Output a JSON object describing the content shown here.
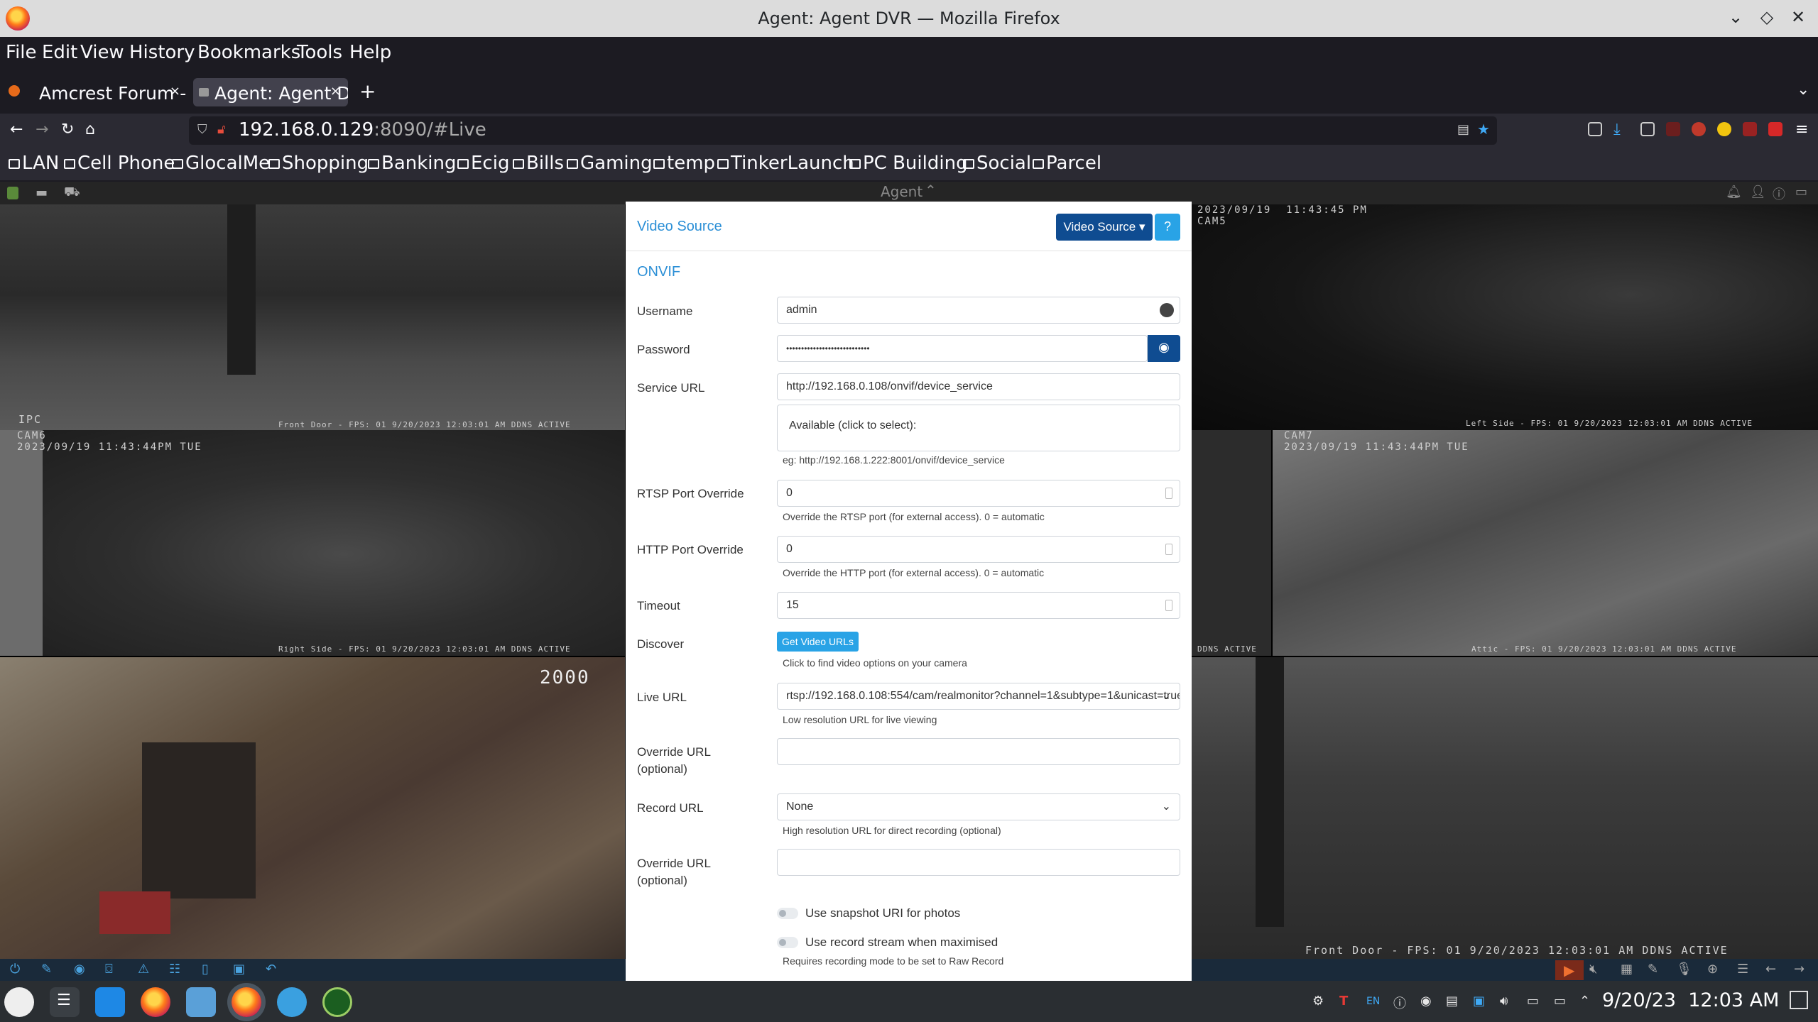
{
  "window": {
    "title": "Agent: Agent DVR — Mozilla Firefox"
  },
  "menubar": {
    "items": [
      "File",
      "Edit",
      "View",
      "History",
      "Bookmarks",
      "Tools",
      "Help"
    ]
  },
  "tabs": [
    {
      "label": "Amcrest Forum -",
      "active": false
    },
    {
      "label": "Agent: Agent D",
      "active": true
    }
  ],
  "url": {
    "host": "192.168.0.129",
    "rest": ":8090/#Live"
  },
  "bookmarks": [
    "LAN",
    "Cell Phone",
    "GlocalMe",
    "Shopping",
    "Banking",
    "Ecig",
    "Bills",
    "Gaming",
    "temp",
    "TinkerLaunch",
    "PC Building",
    "Social",
    "Parcel"
  ],
  "agent_bar": {
    "label": "Agent"
  },
  "cameras": {
    "front_door_top": {
      "top_label": "",
      "bottom_left": "IPC",
      "bottom_right": "Front Door - FPS: 01 9/20/2023 12:03:01 AM DDNS ACTIVE"
    },
    "cam5": {
      "top_label": "2023/09/19  11:43:45 PM\nCAM5",
      "bottom_right": "Left Side - FPS: 01 9/20/2023 12:03:01 AM DDNS ACTIVE"
    },
    "cam6": {
      "top_label": "CAM6\n2023/09/19 11:43:44PM TUE",
      "bottom_right": "Right Side - FPS: 01 9/20/2023 12:03:01 AM DDNS ACTIVE"
    },
    "cam_attic": {
      "top_label": "CAM7\n2023/09/19 11:43:44PM TUE",
      "bottom_right": "Attic - FPS: 01 9/20/2023 12:03:01 AM DDNS ACTIVE"
    },
    "middle": {
      "bottom_right": "DDNS ACTIVE"
    },
    "garage": {
      "top_label": "2000"
    },
    "front_door_bottom": {
      "bottom_right": "Front Door - FPS: 01 9/20/2023 12:03:01 AM DDNS ACTIVE"
    }
  },
  "modal": {
    "title": "Video Source",
    "dropdown_label": "Video Source ▾",
    "help_label": "?",
    "section": "ONVIF",
    "username": {
      "label": "Username",
      "value": "admin"
    },
    "password": {
      "label": "Password",
      "value": "••••••••••••••••••••••••••••"
    },
    "service_url": {
      "label": "Service URL",
      "value": "http://192.168.0.108/onvif/device_service",
      "available": "Available (click to select):",
      "example": "eg: http://192.168.1.222:8001/onvif/device_service"
    },
    "rtsp_port": {
      "label": "RTSP Port Override",
      "value": "0",
      "help": "Override the RTSP port (for external access). 0 = automatic"
    },
    "http_port": {
      "label": "HTTP Port Override",
      "value": "0",
      "help": "Override the HTTP port (for external access). 0 = automatic"
    },
    "timeout": {
      "label": "Timeout",
      "value": "15"
    },
    "discover": {
      "label": "Discover",
      "button": "Get Video URLs",
      "help": "Click to find video options on your camera"
    },
    "live_url": {
      "label": "Live URL",
      "value": "rtsp://192.168.0.108:554/cam/realmonitor?channel=1&subtype=1&unicast=true",
      "help": "Low resolution URL for live viewing"
    },
    "override_url_1": {
      "label1": "Override URL",
      "label2": "(optional)",
      "value": ""
    },
    "record_url": {
      "label": "Record URL",
      "value": "None",
      "help": "High resolution URL for direct recording (optional)"
    },
    "override_url_2": {
      "label1": "Override URL",
      "label2": "(optional)",
      "value": ""
    },
    "snapshot_toggle": {
      "label": "Use snapshot URI for photos",
      "on": false
    },
    "record_stream_toggle": {
      "label": "Use record stream when maximised",
      "on": false,
      "help": "Requires recording mode to be set to Raw Record"
    }
  },
  "taskbar": {
    "datetime": "9/20/23  12:03 AM",
    "lang": "EN"
  }
}
